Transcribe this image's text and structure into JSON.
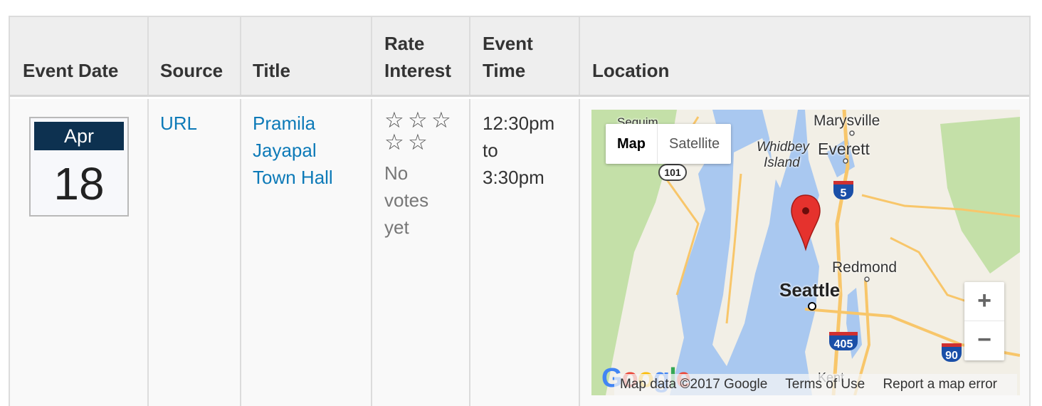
{
  "headers": {
    "event_date": "Event Date",
    "source": "Source",
    "title_line1": "",
    "title": "Title",
    "rate_line1": "Rate",
    "rate_line2": "Interest",
    "time_line1": "Event",
    "time_line2": "Time",
    "location": "Location"
  },
  "event": {
    "month": "Apr",
    "day": "18",
    "source_link": "URL",
    "title_lines": [
      "Pramila",
      "Jayapal",
      "Town Hall"
    ],
    "stars_count": 5,
    "rating_lines": [
      "No",
      "votes",
      "yet"
    ],
    "time_lines": [
      "12:30pm",
      "to",
      "3:30pm"
    ]
  },
  "map": {
    "tab_map": "Map",
    "tab_satellite": "Satellite",
    "zoom_in": "+",
    "zoom_out": "−",
    "logo": "Google",
    "footer_data": "Map data ©2017 Google",
    "footer_terms": "Terms of Use",
    "footer_report": "Report a map error",
    "places": {
      "sequim": "Sequim",
      "marysville": "Marysville",
      "whidbey": "Whidbey",
      "island": "Island",
      "everett": "Everett",
      "redmond": "Redmond",
      "seattle": "Seattle",
      "kent": "Kent"
    },
    "routes": {
      "us101": "101",
      "i5": "5",
      "i405": "405",
      "i90": "90"
    }
  },
  "colors": {
    "header_bg": "#eeeeee",
    "link": "#0d7ab8",
    "calendar_month_bg": "#0d3150",
    "water": "#a9c8f0",
    "land": "#f2efe6",
    "park": "#c4e0a8",
    "road": "#f8c66a",
    "marker": "#e5322d"
  }
}
